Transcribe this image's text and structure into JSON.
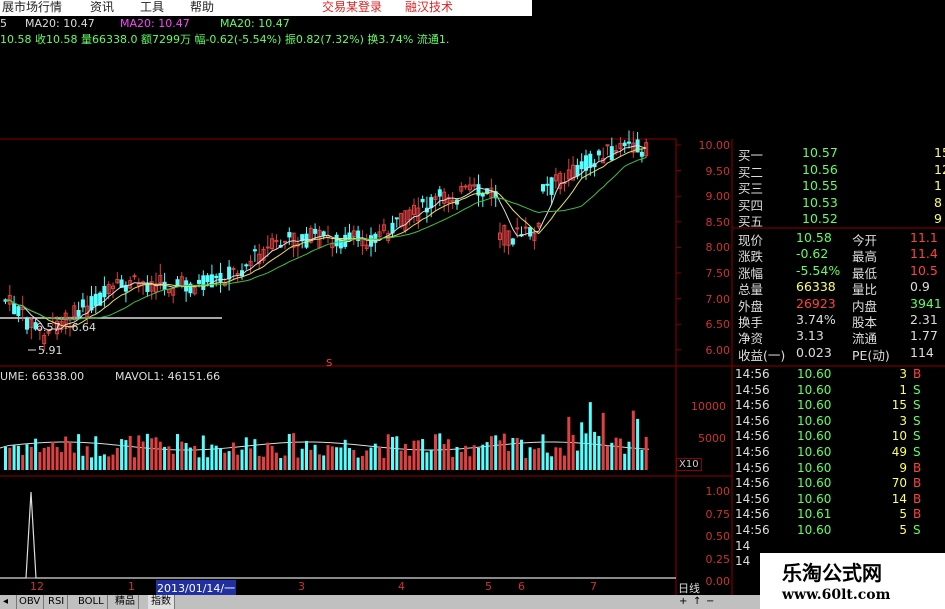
{
  "menu": {
    "items": [
      "展市场行情",
      "资讯",
      "工具",
      "帮助"
    ],
    "right_links": [
      "交易某登录",
      "融汉技术"
    ]
  },
  "header": {
    "row1": [
      "5",
      "MA20: 10.47",
      "MA20: 10.47",
      "MA20: 10.47"
    ],
    "row2": "10.58 收10.58 量66338.0 额7299万 幅-0.62(-5.54%) 振0.82(7.32%) 换3.74% 流通1."
  },
  "price_axis": [
    "10.00",
    "9.50",
    "9.00",
    "8.50",
    "8.00",
    "7.50",
    "7.00",
    "6.50",
    "6.00"
  ],
  "annotations": {
    "range_label": "6.57 - 6.64",
    "low_label": "5.91",
    "marker": "S"
  },
  "volume": {
    "label": "UME: 66338.00",
    "mavol_label": "MAVOL1: 46151.66",
    "axis": [
      "10000",
      "5000"
    ],
    "scale": "X10"
  },
  "indicator": {
    "axis": [
      "1.00",
      "0.75",
      "0.50",
      "0.25",
      "0.00"
    ]
  },
  "x_axis": {
    "labels": [
      "12",
      "1",
      "2013/01/14/一",
      "3",
      "4",
      "5",
      "6",
      "7"
    ],
    "period": "日线"
  },
  "order_book": [
    {
      "label": "买一",
      "price": "10.57",
      "vol": "15"
    },
    {
      "label": "买二",
      "price": "10.56",
      "vol": "12"
    },
    {
      "label": "买三",
      "price": "10.55",
      "vol": "1"
    },
    {
      "label": "买四",
      "price": "10.53",
      "vol": "8"
    },
    {
      "label": "买五",
      "price": "10.52",
      "vol": "9"
    }
  ],
  "stats": [
    {
      "k1": "现价",
      "v1": "10.58",
      "k2": "今开",
      "v2": "11.1"
    },
    {
      "k1": "涨跌",
      "v1": "-0.62",
      "k2": "最高",
      "v2": "11.4"
    },
    {
      "k1": "涨幅",
      "v1": "-5.54%",
      "k2": "最低",
      "v2": "10.5"
    },
    {
      "k1": "总量",
      "v1": "66338",
      "k2": "量比",
      "v2": "0.9"
    },
    {
      "k1": "外盘",
      "v1": "26923",
      "k2": "内盘",
      "v2": "3941"
    },
    {
      "k1": "换手",
      "v1": "3.74%",
      "k2": "股本",
      "v2": "2.31"
    },
    {
      "k1": "净资",
      "v1": "3.13",
      "k2": "流通",
      "v2": "1.77"
    },
    {
      "k1": "收益(一)",
      "v1": "0.023",
      "k2": "PE(动)",
      "v2": "114"
    }
  ],
  "ticks": [
    {
      "time": "14:56",
      "price": "10.60",
      "vol": "3",
      "side": "B"
    },
    {
      "time": "14:56",
      "price": "10.60",
      "vol": "1",
      "side": "S"
    },
    {
      "time": "14:56",
      "price": "10.60",
      "vol": "15",
      "side": "S"
    },
    {
      "time": "14:56",
      "price": "10.60",
      "vol": "3",
      "side": "S"
    },
    {
      "time": "14:56",
      "price": "10.60",
      "vol": "10",
      "side": "S"
    },
    {
      "time": "14:56",
      "price": "10.60",
      "vol": "49",
      "side": "S"
    },
    {
      "time": "14:56",
      "price": "10.60",
      "vol": "9",
      "side": "B"
    },
    {
      "time": "14:56",
      "price": "10.60",
      "vol": "70",
      "side": "B"
    },
    {
      "time": "14:56",
      "price": "10.60",
      "vol": "14",
      "side": "B"
    },
    {
      "time": "14:56",
      "price": "10.61",
      "vol": "5",
      "side": "B"
    },
    {
      "time": "14:56",
      "price": "10.60",
      "vol": "5",
      "side": "S"
    },
    {
      "time": "14",
      "price": "",
      "vol": "",
      "side": ""
    },
    {
      "time": "14",
      "price": "",
      "vol": "",
      "side": ""
    }
  ],
  "tabs": [
    "OBV",
    "RSI",
    "BOLL",
    "精品",
    "指数"
  ],
  "watermark": {
    "title": "乐淘公式网",
    "url": "www.60lt.com"
  },
  "colors": {
    "up": "#e04040",
    "down": "#54ffff",
    "grid": "#8b0000",
    "ma_white": "#dddddd",
    "ma_yellow": "#e8e060",
    "ma_green": "#40c040",
    "label_green": "#40ff40",
    "label_red": "#ff4040"
  }
}
